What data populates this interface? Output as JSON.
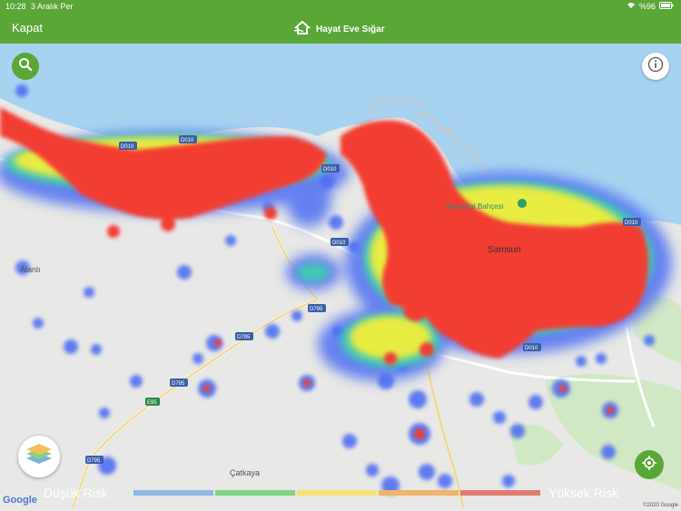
{
  "status_bar": {
    "time": "10:28",
    "date": "3 Aralık Per",
    "battery": "%96"
  },
  "nav": {
    "close_label": "Kapat",
    "brand": "Hayat Eve Sığar"
  },
  "map": {
    "places": [
      {
        "name": "Samsun"
      },
      {
        "name": "Hayvanat Bahçesi"
      },
      {
        "name": "Alanlı"
      },
      {
        "name": "Çatkaya"
      }
    ],
    "roads": [
      "D010",
      "D010",
      "D010",
      "D010",
      "D010",
      "D010",
      "D795",
      "D795",
      "D795",
      "E95",
      "D795"
    ],
    "attribution": "Google",
    "copyright": "©2020 Google"
  },
  "legend": {
    "low_label": "Düşük Risk",
    "high_label": "Yüksek Risk",
    "colors": [
      "#8fb9e6",
      "#7fd67f",
      "#f3e27a",
      "#f0b46a",
      "#e27b72"
    ]
  }
}
